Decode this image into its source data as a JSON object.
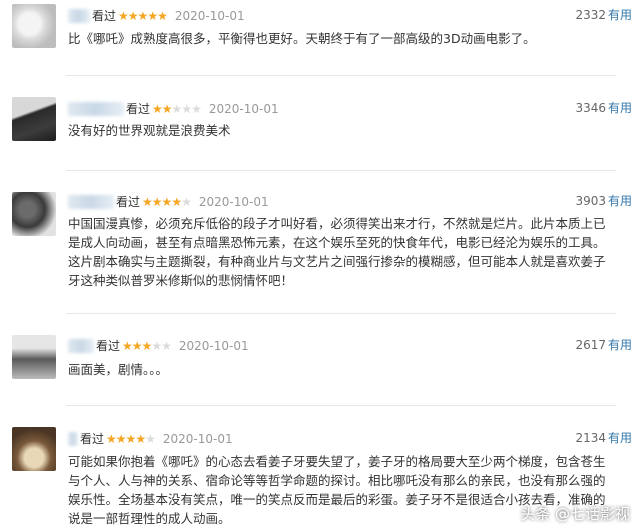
{
  "reviews": [
    {
      "watched": "看过",
      "rating": 5,
      "date": "2020-10-01",
      "votes": "2332",
      "useful": "有用",
      "content": "比《哪吒》成熟度高很多，平衡得也更好。天朝终于有了一部高级的3D动画电影了。"
    },
    {
      "watched": "看过",
      "rating": 2,
      "date": "2020-10-01",
      "votes": "3346",
      "useful": "有用",
      "content": "没有好的世界观就是浪费美术"
    },
    {
      "watched": "看过",
      "rating": 4,
      "date": "2020-10-01",
      "votes": "3903",
      "useful": "有用",
      "content": "中国国漫真惨，必须充斥低俗的段子才叫好看，必须得笑出来才行，不然就是烂片。此片本质上已是成人向动画，甚至有点暗黑恐怖元素，在这个娱乐至死的快食年代，电影已经沦为娱乐的工具。这片剧本确实与主题撕裂，有种商业片与文艺片之间强行掺杂的模糊感，但可能本人就是喜欢姜子牙这种类似普罗米修斯似的悲悯情怀吧！"
    },
    {
      "watched": "看过",
      "rating": 3,
      "date": "2020-10-01",
      "votes": "2617",
      "useful": "有用",
      "content": "画面美，剧情。。。"
    },
    {
      "watched": "看过",
      "rating": 4,
      "date": "2020-10-01",
      "votes": "2134",
      "useful": "有用",
      "content": "可能如果你抱着《哪吒》的心态去看姜子牙要失望了，姜子牙的格局要大至少两个梯度，包含苍生与个人、人与神的关系、宿命论等等哲学命题的探讨。相比哪吒没有那么的亲民，也没有那么强的娱乐性。全场基本没有笑点，唯一的笑点反而是最后的彩蛋。姜子牙不是很适合小孩去看，准确的说是一部哲理性的成人动画。"
    }
  ],
  "watermark": "头条 @七话影视",
  "colors": {
    "star": "#f5a623",
    "star_empty": "#dcdcdc",
    "link": "#3377aa",
    "date": "#999999"
  }
}
